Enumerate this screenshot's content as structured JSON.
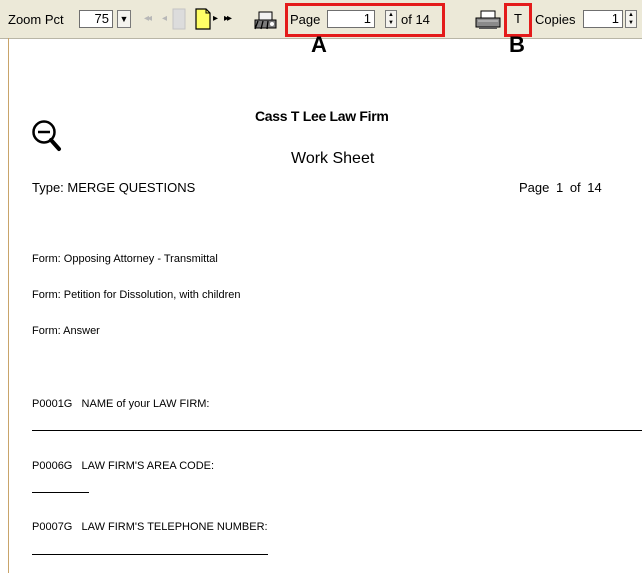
{
  "toolbar": {
    "zoom_label": "Zoom Pct",
    "zoom_value": "75",
    "page_label": "Page",
    "page_value": "1",
    "page_of": "of 14",
    "text_button": "T",
    "copies_label": "Copies",
    "copies_value": "1"
  },
  "callouts": {
    "a": "A",
    "b": "B"
  },
  "document": {
    "firm_name": "Cass T Lee Law Firm",
    "title": "Work Sheet",
    "type_line": "Type: MERGE QUESTIONS",
    "page_info": "Page 1 of 14",
    "forms": [
      "Form: Opposing Attorney - Transmittal",
      "Form: Petition for Dissolution, with children",
      "Form: Answer"
    ],
    "fields": [
      "P0001G   NAME of your LAW FIRM:",
      "P0006G   LAW FIRM'S AREA CODE:",
      "P0007G   LAW FIRM'S TELEPHONE NUMBER:"
    ]
  },
  "icons": [
    "zoom-out-icon",
    "first-page-icon",
    "prev-page-icon",
    "next-page-icon",
    "last-page-icon",
    "print-setup-icon",
    "printer-icon"
  ],
  "colors": {
    "highlight": "#e41b1b",
    "toolbar": "#ece9d8"
  }
}
